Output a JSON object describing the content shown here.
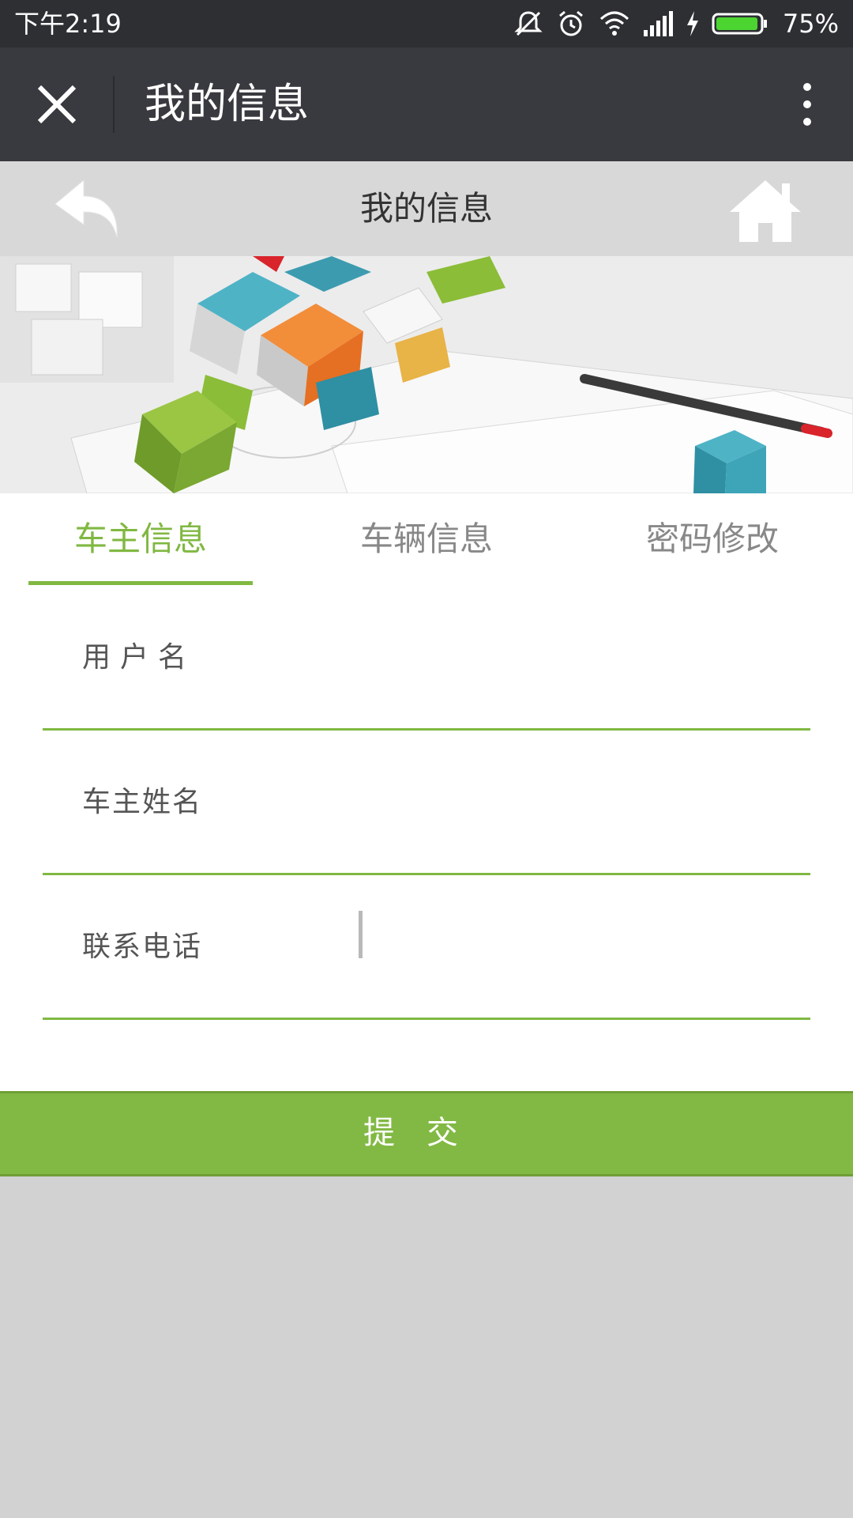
{
  "status_bar": {
    "time": "下午2:19",
    "battery_pct": "75%",
    "icons": [
      "mute-icon",
      "alarm-icon",
      "wifi-icon",
      "signal-icon",
      "charging-icon",
      "battery-icon"
    ]
  },
  "title_bar": {
    "title": "我的信息",
    "close_icon": "close-icon",
    "more_icon": "more-vertical-icon"
  },
  "page_header": {
    "title": "我的信息",
    "back_icon": "back-arrow-icon",
    "home_icon": "home-icon"
  },
  "tabs": [
    {
      "label": "车主信息",
      "active": true
    },
    {
      "label": "车辆信息",
      "active": false
    },
    {
      "label": "密码修改",
      "active": false
    }
  ],
  "form": {
    "fields": [
      {
        "label": "用户名",
        "value": ""
      },
      {
        "label": "车主姓名",
        "value": ""
      },
      {
        "label": "联系电话",
        "value": ""
      }
    ],
    "submit_label": "提交"
  },
  "colors": {
    "accent": "#80b842",
    "status_bar": "#2d2f33",
    "title_bar": "#393a3f",
    "page_header": "#d8d8d8",
    "background": "#d2d2d2"
  }
}
